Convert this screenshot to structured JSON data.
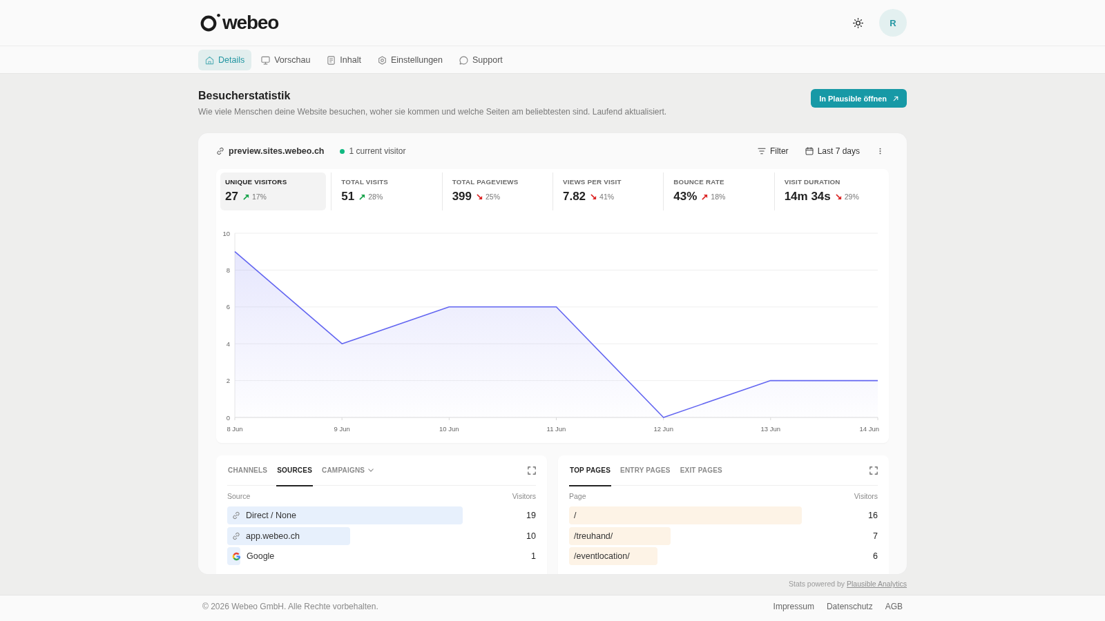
{
  "header": {
    "logo_text": "webeo",
    "avatar_initial": "R"
  },
  "nav": {
    "tabs": [
      {
        "label": "Details",
        "selected": true
      },
      {
        "label": "Vorschau",
        "selected": false
      },
      {
        "label": "Inhalt",
        "selected": false
      },
      {
        "label": "Einstellungen",
        "selected": false
      },
      {
        "label": "Support",
        "selected": false
      }
    ]
  },
  "page": {
    "title": "Besucherstatistik",
    "description": "Wie viele Menschen deine Website besuchen, woher sie kommen und welche Seiten am beliebtesten sind. Laufend aktualisiert.",
    "open_button": "In Plausible öffnen"
  },
  "site_bar": {
    "domain": "preview.sites.webeo.ch",
    "current_visitors": "1 current visitor",
    "filter": "Filter",
    "period": "Last 7 days"
  },
  "stats": [
    {
      "label": "UNIQUE VISITORS",
      "value": "27",
      "change": "17%",
      "rising": true,
      "color": "#16a34a",
      "selected": true
    },
    {
      "label": "TOTAL VISITS",
      "value": "51",
      "change": "28%",
      "rising": true,
      "color": "#16a34a",
      "selected": false
    },
    {
      "label": "TOTAL PAGEVIEWS",
      "value": "399",
      "change": "25%",
      "rising": false,
      "color": "#dc2626",
      "selected": false
    },
    {
      "label": "VIEWS PER VISIT",
      "value": "7.82",
      "change": "41%",
      "rising": false,
      "color": "#dc2626",
      "selected": false
    },
    {
      "label": "BOUNCE RATE",
      "value": "43%",
      "change": "18%",
      "rising": true,
      "color": "#dc2626",
      "selected": false
    },
    {
      "label": "VISIT DURATION",
      "value": "14m 34s",
      "change": "29%",
      "rising": false,
      "color": "#dc2626",
      "selected": false
    }
  ],
  "visitor_chart": {
    "chart_data": {
      "type": "line",
      "categories": [
        "8 Jun",
        "9 Jun",
        "10 Jun",
        "11 Jun",
        "12 Jun",
        "13 Jun",
        "14 Jun"
      ],
      "series": [
        {
          "color": "#6366f1",
          "values": [
            9,
            4,
            6,
            6,
            0,
            2,
            2
          ]
        }
      ],
      "ylim": [
        0,
        10
      ],
      "yticks": [
        0,
        2,
        4,
        6,
        8,
        10
      ],
      "grid": true
    }
  },
  "sources_panel": {
    "tabs": [
      {
        "label": "CHANNELS",
        "selected": false,
        "dropdown": false
      },
      {
        "label": "SOURCES",
        "selected": true,
        "dropdown": false
      },
      {
        "label": "CAMPAIGNS",
        "selected": false,
        "dropdown": true
      }
    ],
    "columns": [
      "Source",
      "Visitors"
    ],
    "rows": [
      {
        "label": "Direct / None",
        "visitors": "19",
        "level": 0.88
      },
      {
        "label": "app.webeo.ch",
        "visitors": "10",
        "level": 0.46
      },
      {
        "label": "Google",
        "visitors": "1",
        "level": 0.05
      }
    ]
  },
  "pages_panel": {
    "tabs": [
      {
        "label": "TOP PAGES",
        "selected": true
      },
      {
        "label": "ENTRY PAGES",
        "selected": false
      },
      {
        "label": "EXIT PAGES",
        "selected": false
      }
    ],
    "columns": [
      "Page",
      "Visitors"
    ],
    "rows": [
      {
        "label": "/",
        "visitors": "16",
        "level": 0.87
      },
      {
        "label": "/treuhand/",
        "visitors": "7",
        "level": 0.38
      },
      {
        "label": "/eventlocation/",
        "visitors": "6",
        "level": 0.33
      }
    ]
  },
  "attribution": {
    "text": "Stats powered by",
    "link": "Plausible Analytics"
  },
  "footer": {
    "copyright": "© 2026 Webeo GmbH. Alle Rechte vorbehalten.",
    "links": [
      "Impressum",
      "Datenschutz",
      "AGB"
    ]
  }
}
